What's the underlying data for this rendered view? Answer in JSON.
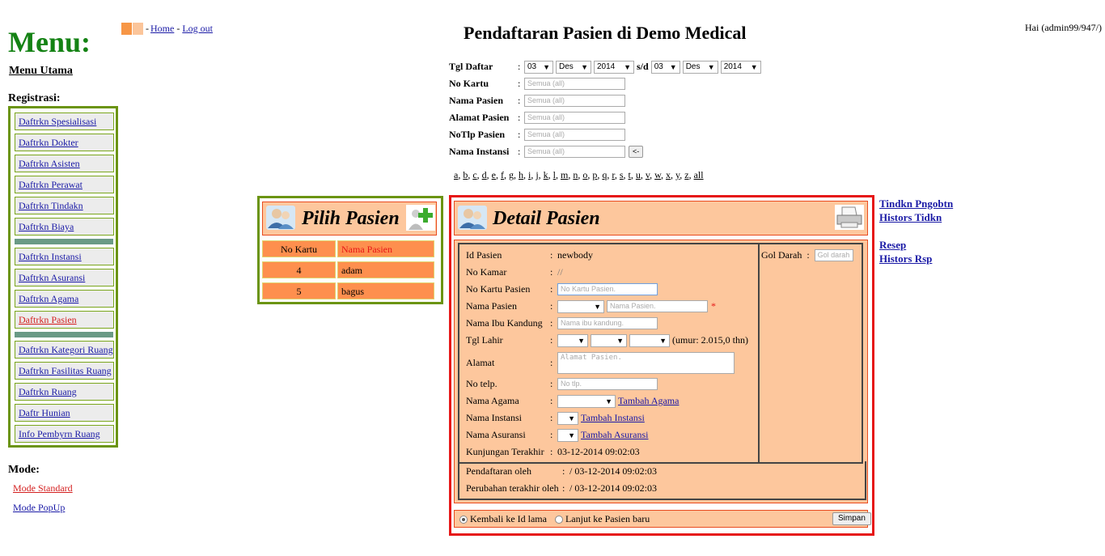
{
  "menu": {
    "title": "Menu:",
    "main_link": "Menu Utama",
    "registrasi_label": "Registrasi:",
    "group1": [
      "Daftrkn Spesialisasi",
      "Daftrkn Dokter",
      "Daftrkn Asisten",
      "Daftrkn Perawat",
      "Daftrkn Tindakn",
      "Daftrkn Biaya"
    ],
    "group2": [
      "Daftrkn Instansi",
      "Daftrkn Asuransi",
      "Daftrkn Agama",
      "Daftrkn Pasien"
    ],
    "group3": [
      "Daftrkn Kategori Ruang",
      "Daftrkn Fasilitas Ruang",
      "Daftrkn Ruang",
      "Daftr Hunian",
      "Info Pembyrn Ruang"
    ],
    "active_item": "Daftrkn Pasien",
    "mode_label": "Mode:",
    "mode_standard": "Mode Standard",
    "mode_popup": "Mode PopUp"
  },
  "topnav": {
    "sep1": "-",
    "home": "Home",
    "sep2": "-",
    "logout": "Log out",
    "square_colors": [
      "#f79646",
      "#fbc59a"
    ]
  },
  "greeting": "Hai (admin99/947/)",
  "page_title": "Pendaftaran Pasien di Demo Medical",
  "filters": {
    "tgl_daftar_label": "Tgl Daftar",
    "from_day": "03",
    "from_month": "Des",
    "from_year": "2014",
    "sd": "s/d",
    "to_day": "03",
    "to_month": "Des",
    "to_year": "2014",
    "no_kartu_label": "No Kartu",
    "nama_pasien_label": "Nama Pasien",
    "alamat_pasien_label": "Alamat Pasien",
    "notlp_pasien_label": "NoTlp Pasien",
    "nama_instansi_label": "Nama Instansi",
    "placeholder": "Semua (all)",
    "go_button": "<-",
    "colon": ":"
  },
  "alphabet": [
    "a",
    "b",
    "c",
    "d",
    "e",
    "f",
    "g",
    "h",
    "i",
    "j",
    "k",
    "l",
    "m",
    "n",
    "o",
    "p",
    "q",
    "r",
    "s",
    "t",
    "u",
    "v",
    "w",
    "x",
    "y",
    "z",
    "all"
  ],
  "pilih": {
    "title": "Pilih Pasien",
    "col_no_kartu": "No Kartu",
    "col_nama": "Nama Pasien",
    "rows": [
      {
        "no": "4",
        "nama": "adam"
      },
      {
        "no": "5",
        "nama": "bagus"
      }
    ]
  },
  "detail": {
    "title": "Detail Pasien",
    "id_label": "Id Pasien",
    "id_value": "newbody",
    "kamar_label": "No Kamar",
    "kamar_value": "//",
    "kartu_label": "No Kartu Pasien",
    "kartu_placeholder": "No Kartu Pasien.",
    "nama_label": "Nama Pasien",
    "nama_placeholder": "Nama Pasien.",
    "required": "*",
    "ibu_label": "Nama Ibu Kandung",
    "ibu_placeholder": "Nama ibu kandung.",
    "lahir_label": "Tgl Lahir",
    "umur": "(umur: 2.015,0 thn)",
    "alamat_label": "Alamat",
    "alamat_placeholder": "Alamat Pasien.",
    "telp_label": "No telp.",
    "telp_placeholder": "No tlp.",
    "agama_label": "Nama Agama",
    "tambah_agama": "Tambah Agama",
    "instansi_label": "Nama Instansi",
    "tambah_instansi": "Tambah Instansi",
    "asuransi_label": "Nama Asuransi",
    "tambah_asuransi": "Tambah Asuransi",
    "kunjungan_label": "Kunjungan Terakhir",
    "kunjungan_value": "03-12-2014 09:02:03",
    "gol_label": "Gol Darah",
    "gol_placeholder": "Gol darah",
    "daftar_oleh_label": "Pendaftaran oleh",
    "daftar_oleh_value": "/ 03-12-2014 09:02:03",
    "ubah_label": "Perubahan terakhir oleh",
    "ubah_value": "/ 03-12-2014 09:02:03",
    "radio_kembali": "Kembali ke Id lama",
    "radio_lanjut": "Lanjut ke Pasien baru",
    "simpan": "Simpan",
    "colon": ":"
  },
  "side_links": [
    "Tindkn Pngobtn",
    "Histors Tidkn",
    "Resep",
    "Histors Rsp"
  ]
}
